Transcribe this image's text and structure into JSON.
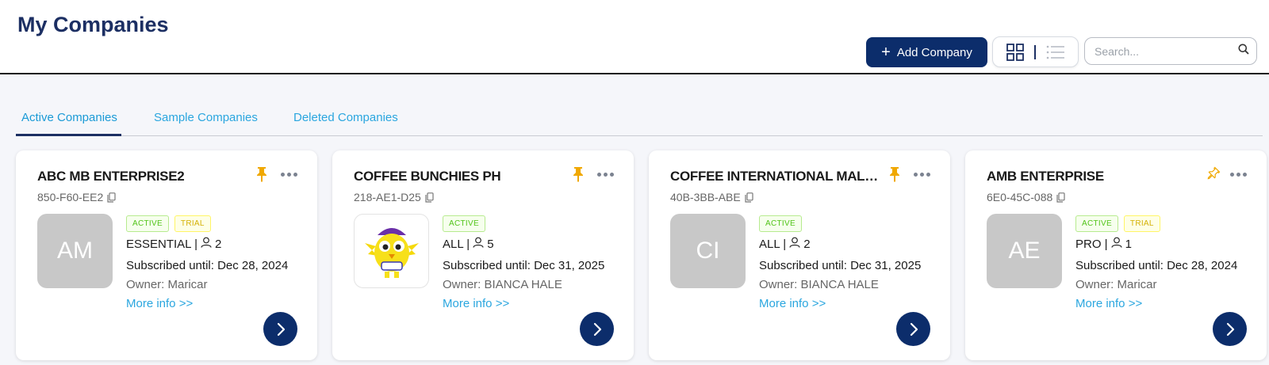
{
  "page": {
    "title": "My Companies"
  },
  "toolbar": {
    "add_button_label": "Add Company",
    "search_placeholder": "Search..."
  },
  "tabs": [
    {
      "label": "Active Companies",
      "active": true
    },
    {
      "label": "Sample Companies",
      "active": false
    },
    {
      "label": "Deleted Companies",
      "active": false
    }
  ],
  "colors": {
    "primary": "#0c2d6b",
    "link": "#2aa6df",
    "pin": "#f0a800",
    "active_badge": "#52c41a",
    "trial_badge": "#d4b106"
  },
  "cards": [
    {
      "name": "ABC MB ENTERPRISE2",
      "code": "850-F60-EE2",
      "initials": "AM",
      "has_image": false,
      "badges": [
        "ACTIVE",
        "TRIAL"
      ],
      "plan": "ESSENTIAL |",
      "users": "2",
      "subscribed": "Subscribed until: Dec 28, 2024",
      "owner": "Owner: Maricar",
      "more_info": "More info >>",
      "pinned": true
    },
    {
      "name": "COFFEE BUNCHIES PH",
      "code": "218-AE1-D25",
      "initials": "",
      "has_image": true,
      "badges": [
        "ACTIVE"
      ],
      "plan": "ALL |",
      "users": "5",
      "subscribed": "Subscribed until: Dec 31, 2025",
      "owner": "Owner: BIANCA HALE",
      "more_info": "More info >>",
      "pinned": true
    },
    {
      "name": "COFFEE INTERNATIONAL MALAYSIA",
      "code": "40B-3BB-ABE",
      "initials": "CI",
      "has_image": false,
      "badges": [
        "ACTIVE"
      ],
      "plan": "ALL |",
      "users": "2",
      "subscribed": "Subscribed until: Dec 31, 2025",
      "owner": "Owner: BIANCA HALE",
      "more_info": "More info >>",
      "pinned": true
    },
    {
      "name": "AMB ENTERPRISE",
      "code": "6E0-45C-088",
      "initials": "AE",
      "has_image": false,
      "badges": [
        "ACTIVE",
        "TRIAL"
      ],
      "plan": "PRO |",
      "users": "1",
      "subscribed": "Subscribed until: Dec 28, 2024",
      "owner": "Owner: Maricar",
      "more_info": "More info >>",
      "pinned": false
    }
  ]
}
